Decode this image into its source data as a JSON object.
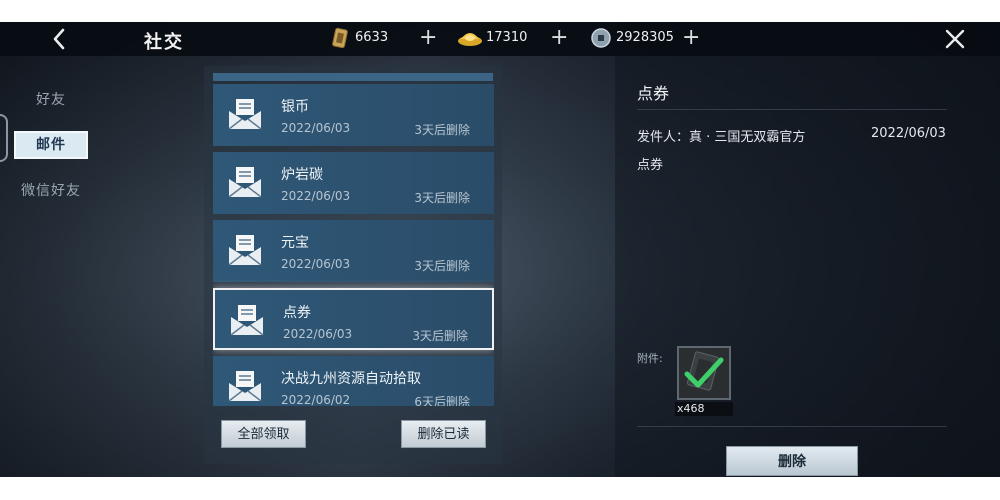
{
  "header": {
    "title": "社交",
    "currencies": [
      {
        "icon": "gold-ticket-icon",
        "value": "6633"
      },
      {
        "icon": "gold-ingot-icon",
        "value": "17310"
      },
      {
        "icon": "coin-icon",
        "value": "2928305"
      }
    ]
  },
  "sidebar": {
    "tabs": [
      {
        "label": "好友",
        "active": false
      },
      {
        "label": "邮件",
        "active": true
      },
      {
        "label": "微信好友",
        "active": false
      }
    ]
  },
  "mail_list": {
    "items": [
      {
        "subject": "银币",
        "date": "2022/06/03",
        "expire": "3天后删除",
        "selected": false
      },
      {
        "subject": "炉岩碳",
        "date": "2022/06/03",
        "expire": "3天后删除",
        "selected": false
      },
      {
        "subject": "元宝",
        "date": "2022/06/03",
        "expire": "3天后删除",
        "selected": false
      },
      {
        "subject": "点券",
        "date": "2022/06/03",
        "expire": "3天后删除",
        "selected": true
      },
      {
        "subject": "决战九州资源自动拾取",
        "date": "2022/06/02",
        "expire": "6天后删除",
        "selected": false
      }
    ],
    "claim_all_label": "全部领取",
    "delete_read_label": "删除已读"
  },
  "detail": {
    "title": "点券",
    "sender": "发件人：真 · 三国无双霸官方",
    "date": "2022/06/03",
    "body": "点券",
    "attachment_label": "附件:",
    "attachment": {
      "icon": "voucher-item-icon",
      "count": "x468",
      "claimed": true
    },
    "delete_label": "删除"
  },
  "colors": {
    "accent": "#2f5878",
    "check": "#3ecf6a"
  }
}
